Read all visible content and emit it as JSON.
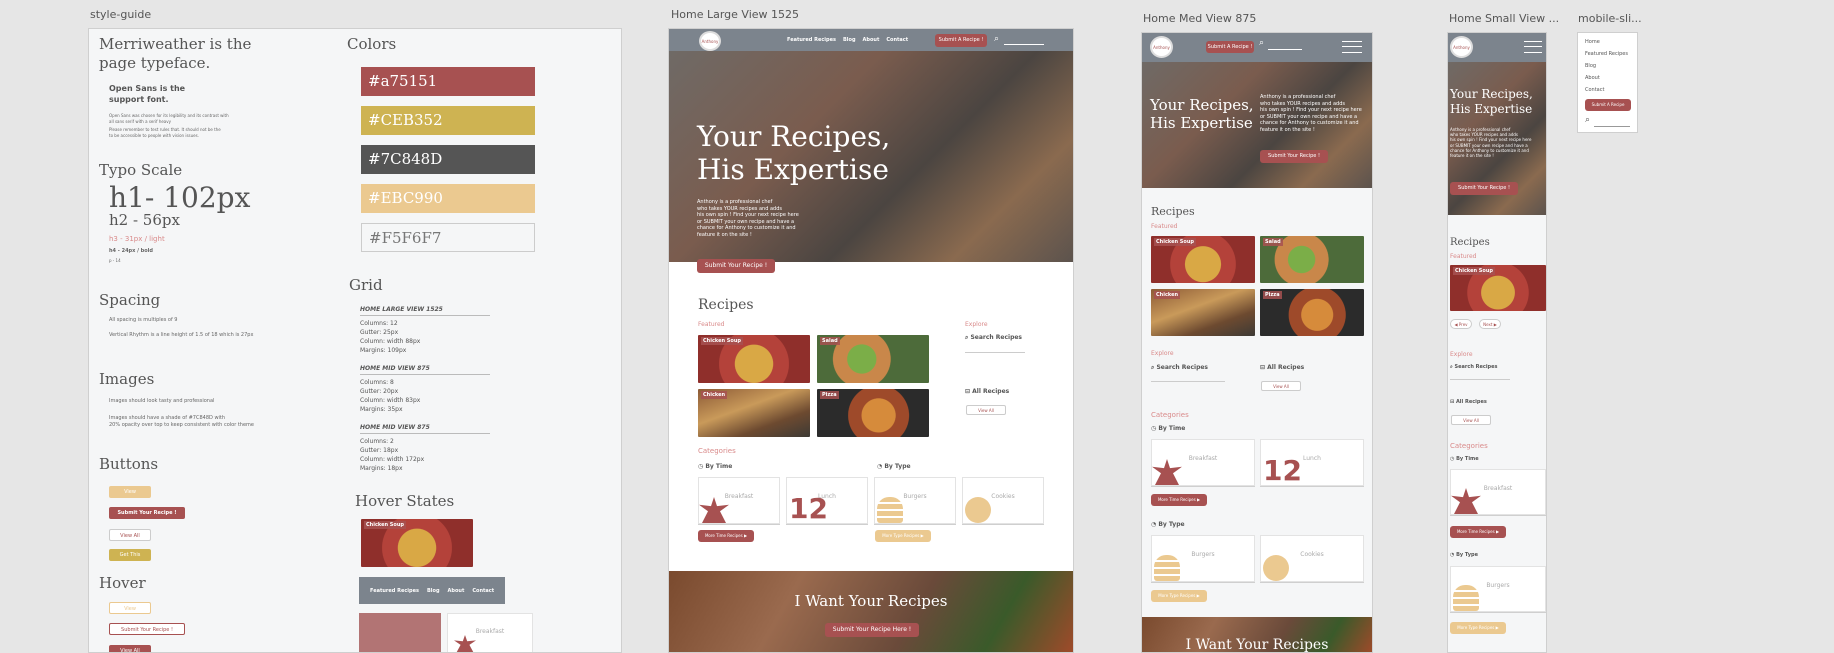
{
  "labels": {
    "style_guide": "style-guide",
    "home_large": "Home Large View 1525",
    "home_med": "Home Med View 875",
    "home_small": "Home Small View ...",
    "mobile": "mobile-sli..."
  },
  "style_guide": {
    "typeface_line1": "Merriweather is the",
    "typeface_line2": "page typeface.",
    "support_line1": "Open Sans is the",
    "support_line2": "support font.",
    "support_note1": "Open Sans was chosen for its legibility and its contrast with",
    "support_note2": "all sans serif with a serif heavy",
    "support_note3": "Please remember to test rules that. It should not be the",
    "support_note4": "to be accessible to people with vision issues.",
    "typo_title": "Typo Scale",
    "h1": "h1- 102px",
    "h2": "h2 - 56px",
    "h3": "h3 - 31px / light",
    "h4": "h4 - 24px / bold",
    "p": "p - 14",
    "spacing_title": "Spacing",
    "spacing_1": "All spacing is multiples of 9",
    "spacing_2": "Vertical Rhythm is a line height of 1.5 of 18 which is 27px",
    "images_title": "Images",
    "images_1": "Images should look tasty and professional",
    "images_2": "Images should have a shade of #7C848D  with",
    "images_3": "20% opacity over top to keep consistent with color theme",
    "buttons_title": "Buttons",
    "btn_view": "View",
    "btn_submit": "Submit Your Recipe !",
    "btn_viewall": "View All",
    "btn_get": "Get This",
    "hover_title": "Hover",
    "hover_view": "View",
    "hover_submit": "Submit Your Recipe !",
    "hover_viewall": "View All",
    "colors_title": "Colors",
    "colors": [
      {
        "hex": "#a75151",
        "label": "#a75151"
      },
      {
        "hex": "#CEB352",
        "label": "#CEB352"
      },
      {
        "hex": "#7C848D",
        "label": "#7C848D"
      },
      {
        "hex": "#EBC990",
        "label": "#EBC990"
      },
      {
        "hex": "#F5F6F7",
        "label": "#F5F6F7"
      }
    ],
    "grid_title": "Grid",
    "grids": [
      {
        "head": "HOME LARGE VIEW 1525",
        "columns": "Columns: 12",
        "gutter": "Gutter: 25px",
        "column": "Column: width 88px",
        "margins": "Margins: 109px"
      },
      {
        "head": "HOME MID VIEW 875",
        "columns": "Columns: 8",
        "gutter": "Gutter: 20px",
        "column": "Column: width 83px",
        "margins": "Margins: 35px"
      },
      {
        "head": "HOME MID VIEW 875",
        "columns": "Columns: 2",
        "gutter": "Gutter: 18px",
        "column": "Column: width 172px",
        "margins": "Margins: 18px"
      }
    ],
    "hover_states_title": "Hover States",
    "hs_card": "Chicken Soup",
    "hs_nav": [
      "Featured Recipes",
      "Blog",
      "About",
      "Contact"
    ],
    "hs_breakfast": "Breakfast"
  },
  "large": {
    "logo": "Anthony",
    "nav": [
      "Featured Recipes",
      "Blog",
      "About",
      "Contact"
    ],
    "submit": "Submit A Recipe !",
    "hero_title1": "Your Recipes,",
    "hero_title2": "His Expertise",
    "hero_text": [
      "Anthony is a professional chef",
      "who takes YOUR recipes and adds",
      "his own spin ! Find your next recipe here",
      "or SUBMIT your own recipe and have a",
      "chance for Anthony to customize it and",
      "feature it on the site !"
    ],
    "hero_btn": "Submit Your Recipe !",
    "recipes": "Recipes",
    "featured": "Featured",
    "cards": [
      "Chicken Soup",
      "Salad",
      "Chicken",
      "Pizza"
    ],
    "explore": "Explore",
    "search_recipes": "Search Recipes",
    "all_recipes": "All Recipes",
    "view_all": "View All",
    "categories": "Categories",
    "by_time": "By Time",
    "by_type": "By Type",
    "breakfast": "Breakfast",
    "lunch": "Lunch",
    "burgers": "Burgers",
    "cookies": "Cookies",
    "twelve": "12",
    "more_time": "More Time Recipes",
    "more_type": "More Type Recipes",
    "want": "I Want Your Recipes",
    "want_btn": "Submit Your Recipe Here !"
  },
  "med": {
    "submit": "Submit A Recipe !",
    "hero_title1": "Your Recipes,",
    "hero_title2": "His Expertise",
    "hero_text": [
      "Anthony is a professional chef",
      "who takes YOUR recipes and adds",
      "his own spin ! Find your next recipe here",
      "or SUBMIT your own recipe and have a",
      "chance for Anthony to customize it and",
      "feature it on the site !"
    ],
    "hero_btn": "Submit Your Recipe !",
    "recipes": "Recipes",
    "featured": "Featured",
    "cards": [
      "Chicken Soup",
      "Salad",
      "Chicken",
      "Pizza"
    ],
    "explore": "Explore",
    "search_recipes": "Search Recipes",
    "all_recipes": "All Recipes",
    "view_all": "View All",
    "categories": "Categories",
    "by_time": "By Time",
    "by_type": "By Type",
    "breakfast": "Breakfast",
    "lunch": "Lunch",
    "burgers": "Burgers",
    "cookies": "Cookies",
    "twelve": "12",
    "more_time": "More Time Recipes",
    "more_type": "More Type Recipes",
    "want": "I Want Your Recipes"
  },
  "small": {
    "hero_title1": "Your Recipes,",
    "hero_title2": "His Expertise",
    "hero_text": [
      "Anthony is a professional chef",
      "who takes YOUR recipes and adds",
      "his own spin ! Find your next recipe here",
      "or SUBMIT your own recipe and have a",
      "chance for Anthony to customize it and",
      "feature it on the site !"
    ],
    "hero_btn": "Submit Your Recipe !",
    "recipes": "Recipes",
    "featured": "Featured",
    "card": "Chicken Soup",
    "prev": "Prev",
    "next": "Next",
    "explore": "Explore",
    "search_recipes": "Search Recipes",
    "all_recipes": "All Recipes",
    "view_all": "View All",
    "categories": "Categories",
    "by_time": "By Time",
    "breakfast": "Breakfast",
    "more_time": "More Time Recipes",
    "by_type": "By Type",
    "burgers": "Burgers",
    "more_type": "More Type Recipes"
  },
  "mobile": {
    "items": [
      "Home",
      "Featured Recipes",
      "Blog",
      "About",
      "Contact"
    ],
    "submit": "Submit A Recipe"
  }
}
